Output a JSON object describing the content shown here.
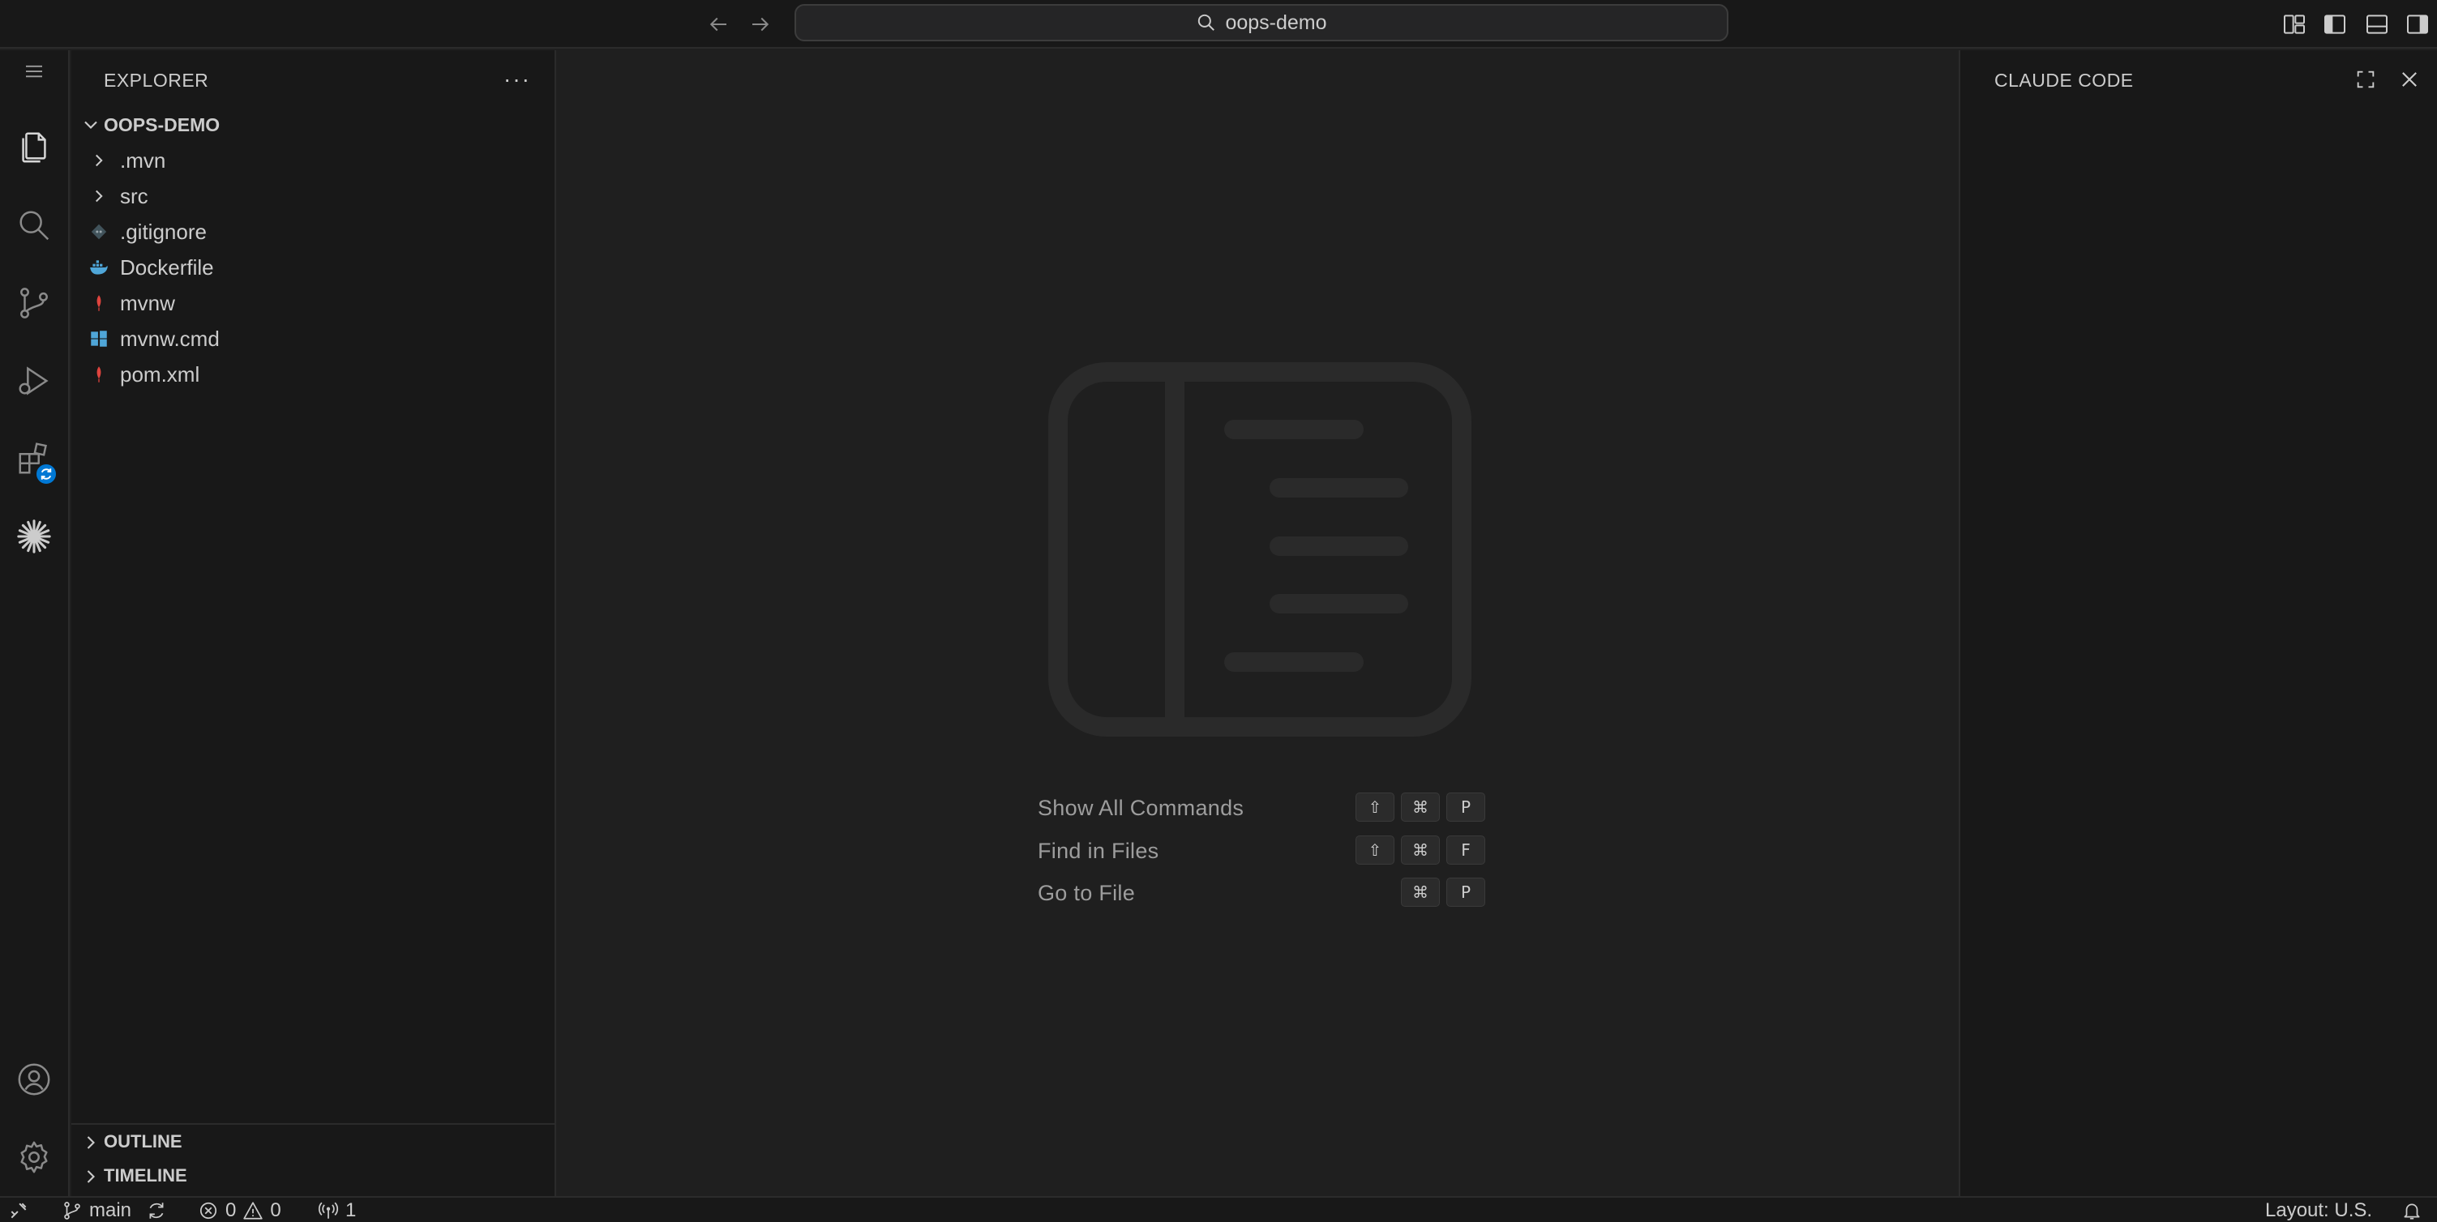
{
  "titlebar": {
    "search_text": "oops-demo"
  },
  "icons": {
    "back": "arrow-left-icon",
    "forward": "arrow-right-icon",
    "search": "search-icon"
  },
  "sidebar": {
    "title": "EXPLORER",
    "more_label": "···",
    "project": "OOPS-DEMO",
    "items": [
      {
        "label": ".mvn",
        "icon": "chevron-right-icon",
        "kind": "folder"
      },
      {
        "label": "src",
        "icon": "chevron-right-icon",
        "kind": "folder"
      },
      {
        "label": ".gitignore",
        "icon": "git-icon",
        "kind": "file"
      },
      {
        "label": "Dockerfile",
        "icon": "docker-icon",
        "kind": "file"
      },
      {
        "label": "mvnw",
        "icon": "maven-icon",
        "kind": "file"
      },
      {
        "label": "mvnw.cmd",
        "icon": "windows-icon",
        "kind": "file"
      },
      {
        "label": "pom.xml",
        "icon": "maven-icon",
        "kind": "file"
      }
    ],
    "sections": [
      {
        "label": "OUTLINE"
      },
      {
        "label": "TIMELINE"
      }
    ]
  },
  "editor": {
    "commands": [
      {
        "label": "Show All Commands",
        "keys": [
          "⇧",
          "⌘",
          "P"
        ]
      },
      {
        "label": "Find in Files",
        "keys": [
          "⇧",
          "⌘",
          "F"
        ]
      },
      {
        "label": "Go to File",
        "keys": [
          "⌘",
          "P"
        ]
      }
    ]
  },
  "aux": {
    "title": "CLAUDE CODE"
  },
  "statusbar": {
    "branch": "main",
    "errors": "0",
    "warnings": "0",
    "ports": "1",
    "layout": "Layout: U.S."
  },
  "colors": {
    "accent": "#0078d4",
    "maven": "#e0443e",
    "docker": "#4fa6d8",
    "windows": "#4fa6d8",
    "git": "#5a6b7a"
  }
}
